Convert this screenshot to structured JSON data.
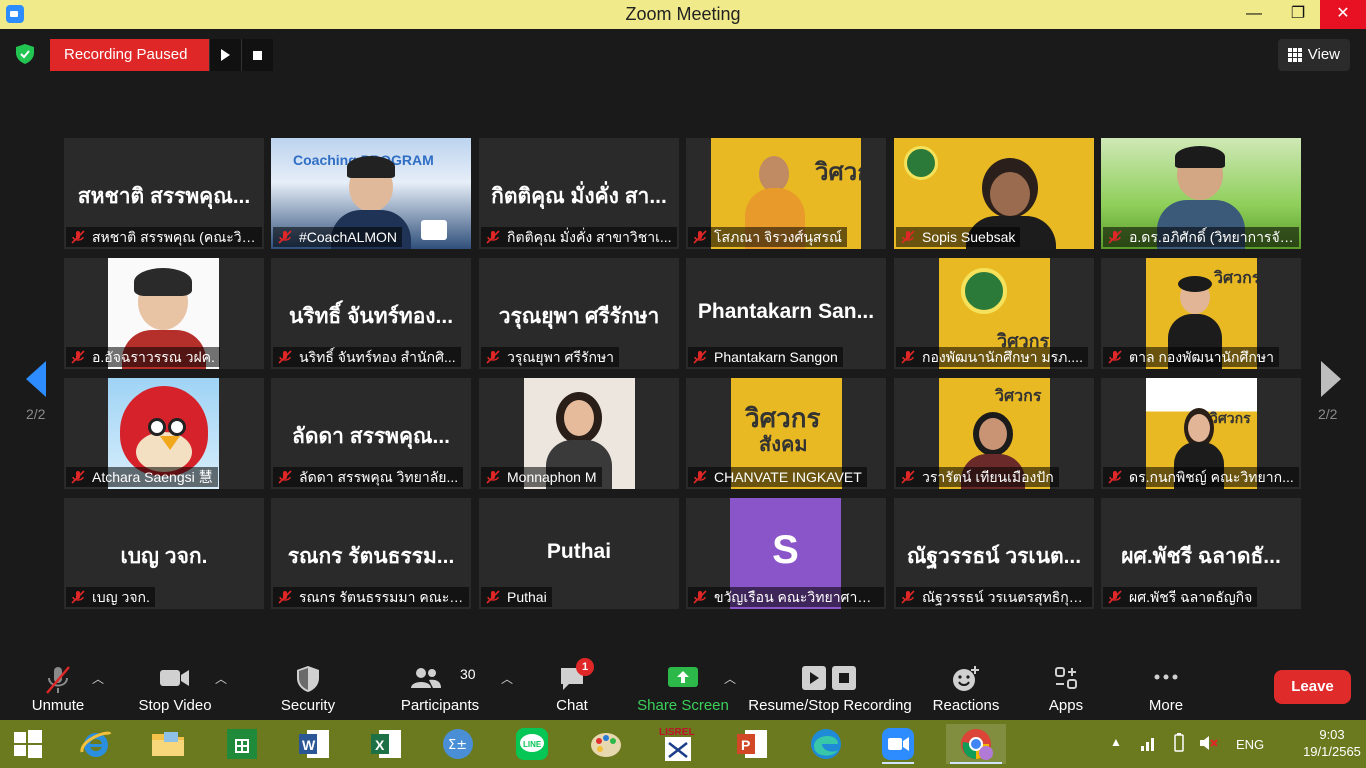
{
  "window": {
    "title": "Zoom Meeting",
    "minimize": "—",
    "maximize": "❐",
    "close": "✕"
  },
  "recording": {
    "status": "Recording Paused"
  },
  "view_button": {
    "label": "View"
  },
  "pagination": {
    "left": "2/2",
    "right": "2/2"
  },
  "tiles": [
    {
      "big_name": "สหชาติ สรรพคุณ...",
      "label": "สหชาติ สรรพคุณ (คณะวิท..."
    },
    {
      "big_name": "",
      "label": "#CoachALMON",
      "video_text": "Coaching PROGRAM"
    },
    {
      "big_name": "กิตติคุณ  มั่งคั่ง สา...",
      "label": "กิตติคุณ  มั่งคั่ง สาขาวิชาเ..."
    },
    {
      "big_name": "",
      "label": "โสภณา จิรวงศ์นุสรณ์"
    },
    {
      "big_name": "",
      "label": "Sopis Suebsak"
    },
    {
      "big_name": "",
      "label": "อ.ดร.อภิศักดิ์ (วิทยาการจัด..."
    },
    {
      "big_name": "",
      "label": "อ.อัจฉราวรรณ วฝค."
    },
    {
      "big_name": "นริทธิ์ จันทร์ทอง...",
      "label": "นริทธิ์ จันทร์ทอง สำนักศิ..."
    },
    {
      "big_name": "วรุณยุพา ศรีรักษา",
      "label": "วรุณยุพา ศรีรักษา"
    },
    {
      "big_name": "Phantakarn  San...",
      "label": "Phantakarn Sangon"
    },
    {
      "big_name": "",
      "label": "กองพัฒนานักศึกษา มรภ...."
    },
    {
      "big_name": "",
      "label": "ตาล กองพัฒนานักศึกษา"
    },
    {
      "big_name": "",
      "label": "Atchara Saengsi 慧"
    },
    {
      "big_name": "ลัดดา สรรพคุณ...",
      "label": "ลัดดา สรรพคุณ  วิทยาลัย..."
    },
    {
      "big_name": "",
      "label": "Monnaphon M"
    },
    {
      "big_name": "",
      "label": "CHANVATE INGKAVET"
    },
    {
      "big_name": "",
      "label": "วรารัตน์ เทียนเมืองปัก"
    },
    {
      "big_name": "",
      "label": "ดร.กนกพิชญ์ คณะวิทยาก..."
    },
    {
      "big_name": "เบญ วจก.",
      "label": "เบญ วจก."
    },
    {
      "big_name": "รณกร รัตนธรรม...",
      "label": "รณกร รัตนธรรมมา คณะวิ..."
    },
    {
      "big_name": "Puthai",
      "label": "Puthai"
    },
    {
      "big_name": "",
      "label": "ขวัญเรือน คณะวิทยาศาสต...",
      "avatar_letter": "S"
    },
    {
      "big_name": "ณัฐวรรธน์ วรเนต...",
      "label": "ณัฐวรรธน์ วรเนตรสุทธิกุล ..."
    },
    {
      "big_name": "ผศ.พัชรี  ฉลาดธั...",
      "label": "ผศ.พัชรี  ฉลาดธัญกิจ"
    }
  ],
  "poster_text": {
    "line1": "วิศวกร",
    "line2": "สังคม"
  },
  "toolbar": {
    "unmute": "Unmute",
    "stop_video": "Stop Video",
    "security": "Security",
    "participants": "Participants",
    "participants_count": "30",
    "chat": "Chat",
    "chat_badge": "1",
    "share_screen": "Share Screen",
    "resume_stop": "Resume/Stop Recording",
    "reactions": "Reactions",
    "apps": "Apps",
    "more": "More",
    "leave": "Leave"
  },
  "taskbar": {
    "lang": "ENG",
    "time": "9:03",
    "date": "19/1/2565",
    "lisrel": "LISREL"
  },
  "colors": {
    "accent_green": "#3ccf5a",
    "leave_red": "#e02b2b",
    "recording_red": "#e02727",
    "taskbar": "#6b7a1e",
    "titlebar": "#f1ea8a"
  }
}
